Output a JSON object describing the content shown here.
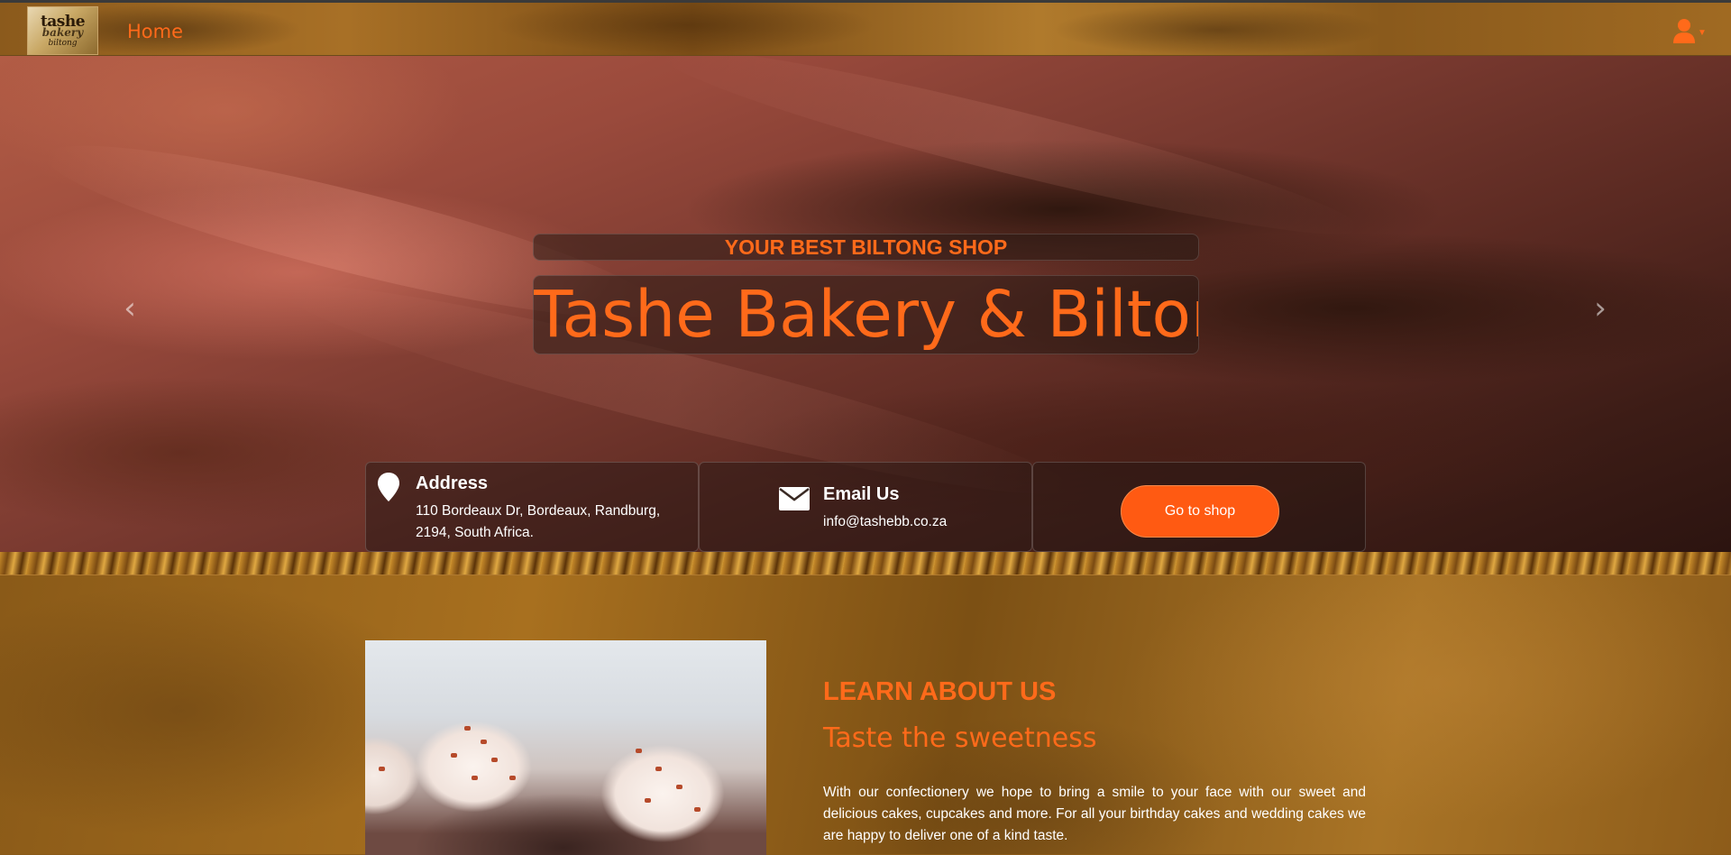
{
  "navbar": {
    "logo_line1": "tashe",
    "logo_line2": "bakery",
    "logo_line3": "biltong",
    "home_label": "Home",
    "user_icon": "user-icon",
    "accent_color": "#ff6a1a"
  },
  "hero": {
    "tagline": "YOUR BEST BILTONG SHOP",
    "title": "Tashe Bakery & Biltong",
    "prev_icon": "chevron-left-icon",
    "next_icon": "chevron-right-icon",
    "address": {
      "icon": "map-pin-icon",
      "title": "Address",
      "line1": "110 Bordeaux Dr, Bordeaux, Randburg,",
      "line2": "2194, South Africa."
    },
    "email": {
      "icon": "envelope-icon",
      "title": "Email Us",
      "value": "info@tashebb.co.za"
    },
    "shop_button": "Go to shop"
  },
  "about": {
    "heading": "LEARN ABOUT US",
    "subheading": "Taste the sweetness",
    "text": "With our confectionery we hope to bring a smile to your face with our sweet and delicious cakes, cupcakes and more. For all your birthday cakes and wedding cakes we are happy to deliver one of a kind taste."
  }
}
